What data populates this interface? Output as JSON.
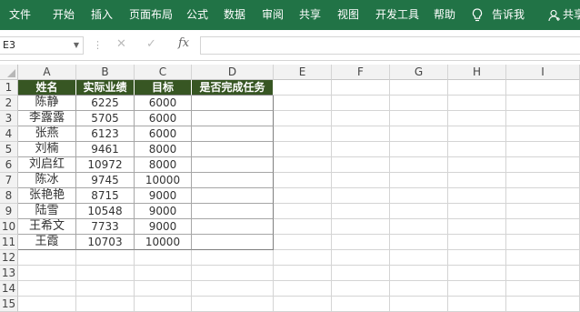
{
  "ribbon": {
    "tabs": [
      "文件",
      "开始",
      "插入",
      "页面布局",
      "公式",
      "数据",
      "审阅",
      "共享",
      "视图",
      "开发工具",
      "帮助"
    ],
    "tell_me": "告诉我",
    "share": "共享"
  },
  "formula_bar": {
    "name_box": "E3",
    "fx_label": "fx",
    "formula": ""
  },
  "sheet": {
    "columns": [
      "A",
      "B",
      "C",
      "D",
      "E",
      "F",
      "G",
      "H",
      "I"
    ],
    "rows": [
      "1",
      "2",
      "3",
      "4",
      "5",
      "6",
      "7",
      "8",
      "9",
      "10",
      "11",
      "12",
      "13",
      "14",
      "15"
    ],
    "header": [
      "姓名",
      "实际业绩",
      "目标",
      "是否完成任务"
    ],
    "data": [
      [
        "陈静",
        "6225",
        "6000",
        ""
      ],
      [
        "李露露",
        "5705",
        "6000",
        ""
      ],
      [
        "张燕",
        "6123",
        "6000",
        ""
      ],
      [
        "刘楠",
        "9461",
        "8000",
        ""
      ],
      [
        "刘启红",
        "10972",
        "8000",
        ""
      ],
      [
        "陈冰",
        "9745",
        "10000",
        ""
      ],
      [
        "张艳艳",
        "8715",
        "9000",
        ""
      ],
      [
        "陆雪",
        "10548",
        "9000",
        ""
      ],
      [
        "王希文",
        "7733",
        "9000",
        ""
      ],
      [
        "王霞",
        "10703",
        "10000",
        ""
      ]
    ]
  },
  "colors": {
    "ribbon": "#217346",
    "table_header": "#375623"
  }
}
